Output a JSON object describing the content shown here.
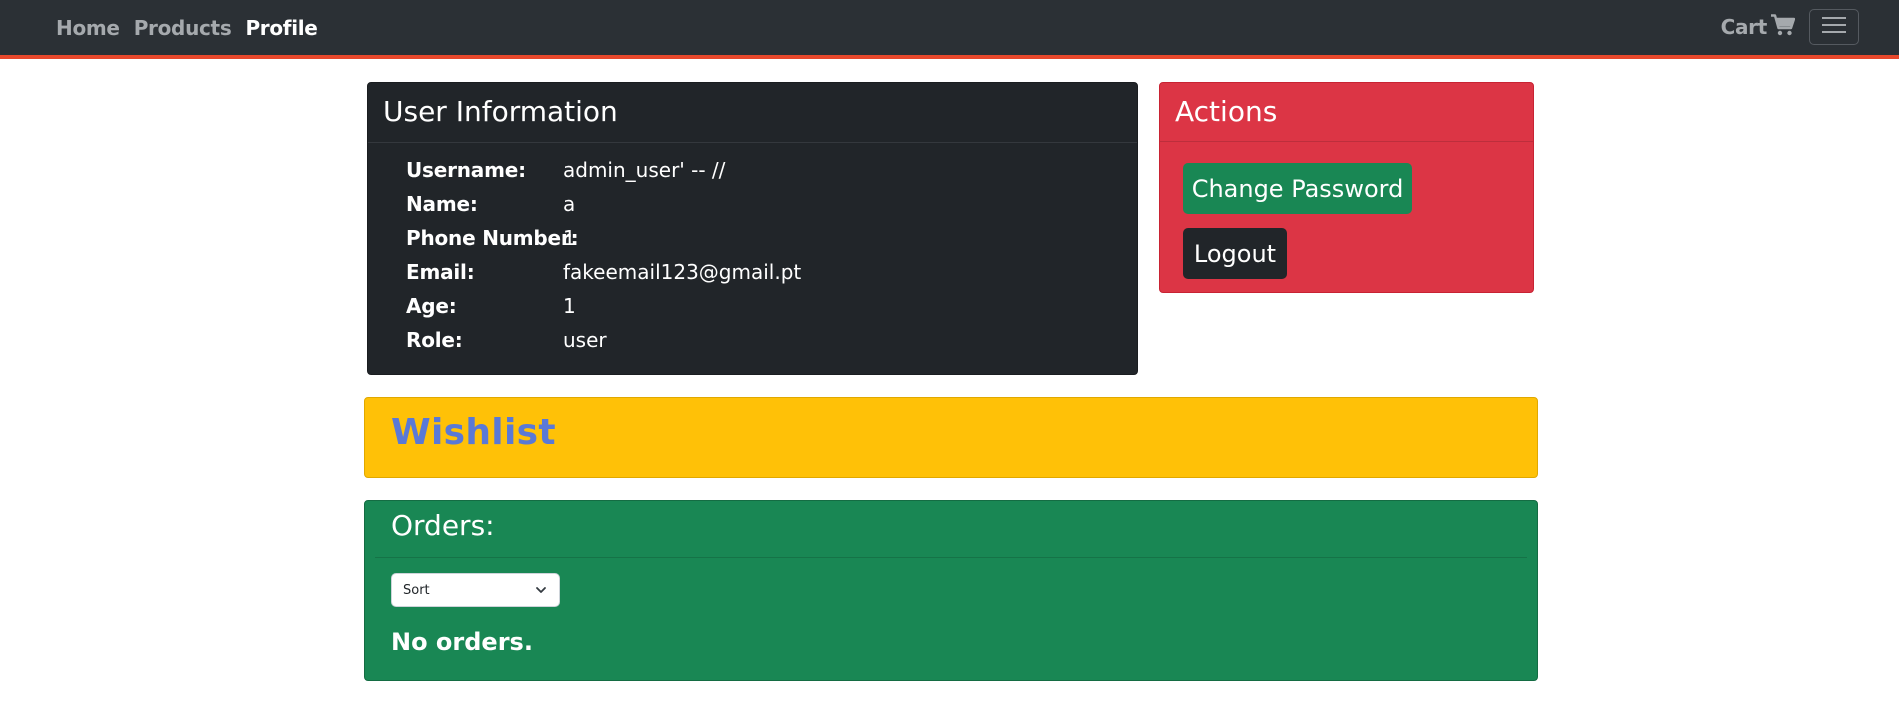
{
  "nav": {
    "links": [
      {
        "label": "Home"
      },
      {
        "label": "Products"
      },
      {
        "label": "Profile"
      }
    ],
    "cart_label": "Cart",
    "cart_icon": "shopping-cart-icon",
    "toggler_icon": "hamburger-menu-icon",
    "accent_color": "#e8482c"
  },
  "user_info": {
    "title": "User Information",
    "fields": [
      {
        "label": "Username:",
        "value": "admin_user' -- //"
      },
      {
        "label": "Name:",
        "value": "a"
      },
      {
        "label": "Phone Number:",
        "value": "1"
      },
      {
        "label": "Email:",
        "value": "fakeemail123@gmail.pt"
      },
      {
        "label": "Age:",
        "value": "1"
      },
      {
        "label": "Role:",
        "value": "user"
      }
    ]
  },
  "actions": {
    "title": "Actions",
    "change_password_label": "Change Password",
    "logout_label": "Logout"
  },
  "wishlist": {
    "title": "Wishlist"
  },
  "orders": {
    "title": "Orders:",
    "sort_selected": "Sort",
    "empty_message": "No orders."
  },
  "colors": {
    "navbar_bg": "#2b3035",
    "user_card_bg": "#212529",
    "actions_bg": "#dc3545",
    "wishlist_bg": "#ffc107",
    "orders_bg": "#198754",
    "change_password_bg": "#198754",
    "logout_bg": "#212529"
  }
}
